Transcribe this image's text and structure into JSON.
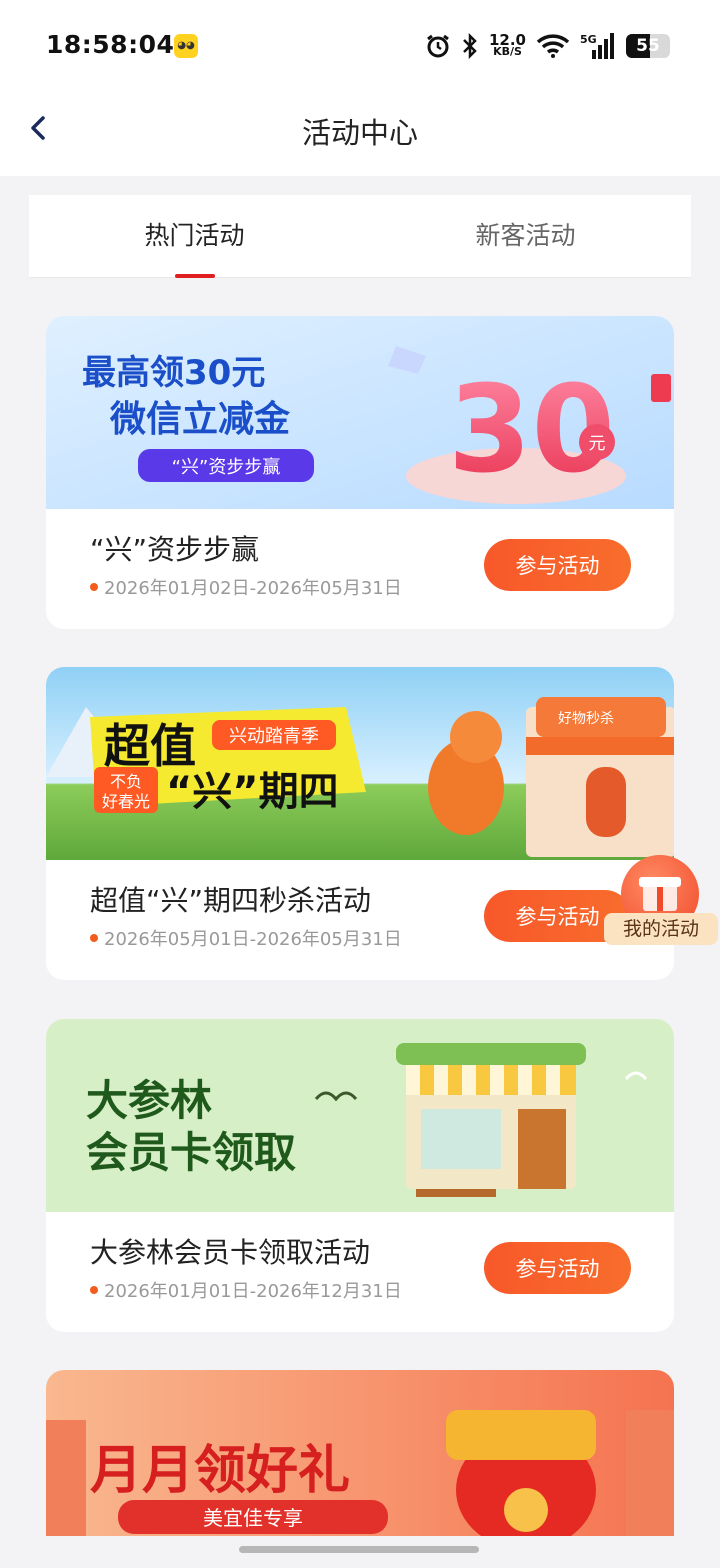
{
  "status_bar": {
    "time": "18:58:04",
    "app_icon": "app-notification-icon",
    "speed_value": "12.0",
    "speed_unit": "KB/S",
    "network": "5G",
    "battery": "55"
  },
  "header": {
    "title": "活动中心",
    "back_icon": "chevron-left-icon"
  },
  "tabs": [
    {
      "label": "热门活动",
      "active": true
    },
    {
      "label": "新客活动",
      "active": false
    }
  ],
  "activities": [
    {
      "title": "“兴”资步步赢",
      "date": "2026年01月02日-2026年05月31日",
      "button": "参与活动",
      "banner": {
        "line1": "最高领30元",
        "line2": "微信立减金",
        "tag": "“兴”资步步赢",
        "big": "30",
        "unit": "元"
      }
    },
    {
      "title": "超值“兴”期四秒杀活动",
      "date": "2026年05月01日-2026年05月31日",
      "button": "参与活动",
      "banner": {
        "line1": "超值",
        "tag": "兴动踏青季",
        "sub1": "不负",
        "sub2": "好春光",
        "line2": "“兴”期四",
        "shop": "好物秒杀"
      }
    },
    {
      "title": "大参林会员卡领取活动",
      "date": "2026年01月01日-2026年12月31日",
      "button": "参与活动",
      "banner": {
        "line1": "大参林",
        "line2": "会员卡领取"
      }
    },
    {
      "title": "",
      "date": "",
      "button": "",
      "banner": {
        "line1": "月月领好礼",
        "tag": "美宜佳专享"
      }
    }
  ],
  "floating": {
    "label": "我的活动",
    "icon": "gift-icon"
  },
  "colors": {
    "accent": "#f8582a",
    "tab_indicator": "#e02020",
    "date_dot": "#f25c1d"
  }
}
